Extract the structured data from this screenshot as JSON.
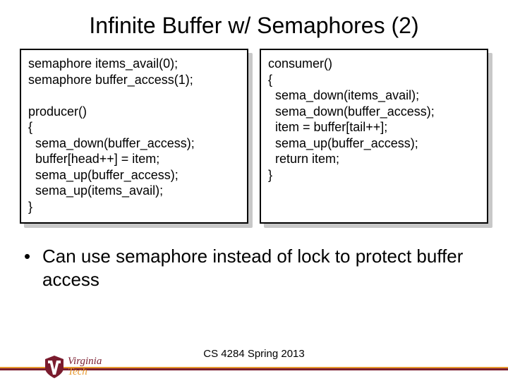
{
  "title": "Infinite Buffer w/ Semaphores (2)",
  "left_code": "semaphore items_avail(0);\nsemaphore buffer_access(1);\n\nproducer()\n{\n  sema_down(buffer_access);\n  buffer[head++] = item;\n  sema_up(buffer_access);\n  sema_up(items_avail);\n}",
  "right_code": "consumer()\n{\n  sema_down(items_avail);\n  sema_down(buffer_access);\n  item = buffer[tail++];\n  sema_up(buffer_access);\n  return item;\n}",
  "bullet_text": "Can use semaphore instead of lock to protect buffer access",
  "footer_course": "CS 4284 Spring 2013",
  "logo": {
    "line1": "Virginia",
    "line2": "Tech"
  },
  "colors": {
    "maroon": "#7a1c2e",
    "orange": "#e6982e"
  }
}
